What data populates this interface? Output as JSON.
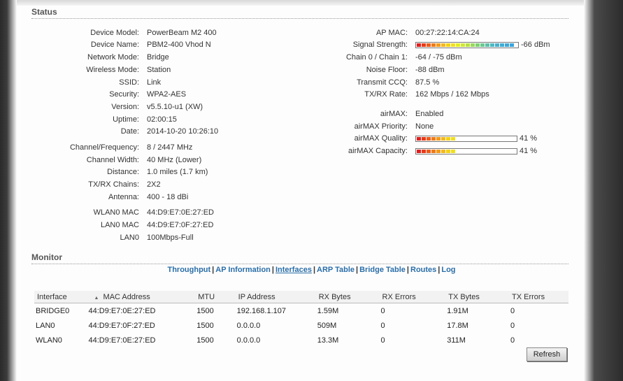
{
  "status": {
    "title": "Status",
    "left": [
      {
        "label": "Device Model:",
        "value": "PowerBeam M2 400"
      },
      {
        "label": "Device Name:",
        "value": "PBM2-400 Vhod N"
      },
      {
        "label": "Network Mode:",
        "value": "Bridge"
      },
      {
        "label": "Wireless Mode:",
        "value": "Station"
      },
      {
        "label": "SSID:",
        "value": "Link"
      },
      {
        "label": "Security:",
        "value": "WPA2-AES"
      },
      {
        "label": "Version:",
        "value": "v5.5.10-u1 (XW)"
      },
      {
        "label": "Uptime:",
        "value": "02:00:15"
      },
      {
        "label": "Date:",
        "value": "2014-10-20 10:26:10"
      },
      {
        "label": "Channel/Frequency:",
        "value": "8 / 2447 MHz"
      },
      {
        "label": "Channel Width:",
        "value": "40 MHz (Lower)"
      },
      {
        "label": "Distance:",
        "value": "1.0 miles (1.7 km)"
      },
      {
        "label": "TX/RX Chains:",
        "value": "2X2"
      },
      {
        "label": "Antenna:",
        "value": "400 - 18 dBi"
      },
      {
        "label": "WLAN0 MAC",
        "value": "44:D9:E7:0E:27:ED"
      },
      {
        "label": "LAN0 MAC",
        "value": "44:D9:E7:0F:27:ED"
      },
      {
        "label": "LAN0",
        "value": "100Mbps-Full"
      }
    ],
    "right": [
      {
        "label": "AP MAC:",
        "value": "00:27:22:14:CA:24"
      },
      {
        "label": "Signal Strength:",
        "value": "-66 dBm"
      },
      {
        "label": "Chain 0 / Chain 1:",
        "value": "-64 / -75 dBm"
      },
      {
        "label": "Noise Floor:",
        "value": "-88 dBm"
      },
      {
        "label": "Transmit CCQ:",
        "value": "87.5 %"
      },
      {
        "label": "TX/RX Rate:",
        "value": "162 Mbps / 162 Mbps"
      },
      {
        "label": "airMAX:",
        "value": "Enabled"
      },
      {
        "label": "airMAX Priority:",
        "value": "None"
      },
      {
        "label": "airMAX Quality:",
        "value": "41 %"
      },
      {
        "label": "airMAX Capacity:",
        "value": "41 %"
      }
    ],
    "meters": {
      "signal_level": 1.0,
      "quality_level": 0.41,
      "capacity_level": 0.41
    }
  },
  "monitor": {
    "title": "Monitor",
    "links": [
      {
        "label": "Throughput",
        "active": false
      },
      {
        "label": "AP Information",
        "active": false
      },
      {
        "label": "Interfaces",
        "active": true
      },
      {
        "label": "ARP Table",
        "active": false
      },
      {
        "label": "Bridge Table",
        "active": false
      },
      {
        "label": "Routes",
        "active": false
      },
      {
        "label": "Log",
        "active": false
      }
    ],
    "separator": "|",
    "columns": [
      "Interface",
      "MAC Address",
      "MTU",
      "IP Address",
      "RX Bytes",
      "RX Errors",
      "TX Bytes",
      "TX Errors"
    ],
    "rows": [
      [
        "BRIDGE0",
        "44:D9:E7:0E:27:ED",
        "1500",
        "192.168.1.107",
        "1.59M",
        "0",
        "1.91M",
        "0"
      ],
      [
        "LAN0",
        "44:D9:E7:0F:27:ED",
        "1500",
        "0.0.0.0",
        "509M",
        "0",
        "17.8M",
        "0"
      ],
      [
        "WLAN0",
        "44:D9:E7:0E:27:ED",
        "1500",
        "0.0.0.0",
        "13.3M",
        "0",
        "311M",
        "0"
      ]
    ],
    "refresh_label": "Refresh"
  }
}
